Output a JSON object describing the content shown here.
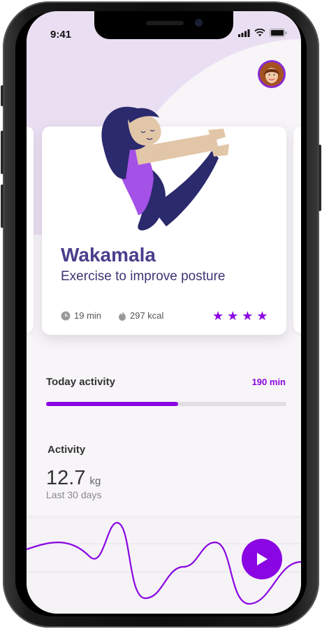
{
  "status_bar": {
    "time": "9:41"
  },
  "exercise_card": {
    "title": "Wakamala",
    "subtitle": "Exercise to improve posture",
    "duration": "19 min",
    "calories": "297 kcal",
    "rating": 4,
    "rating_max": 4
  },
  "today_activity": {
    "label": "Today activity",
    "value": "190 min",
    "progress_fraction": 0.55
  },
  "activity": {
    "label": "Activity",
    "value": "12.7",
    "unit": "kg",
    "period": "Last 30 days"
  },
  "colors": {
    "accent": "#8a06e2",
    "title": "#4a3e8c",
    "background_tint": "#eadff2"
  },
  "icons": [
    "clock-icon",
    "flame-icon",
    "star-icon",
    "play-icon",
    "signal-icon",
    "wifi-icon",
    "battery-icon"
  ]
}
